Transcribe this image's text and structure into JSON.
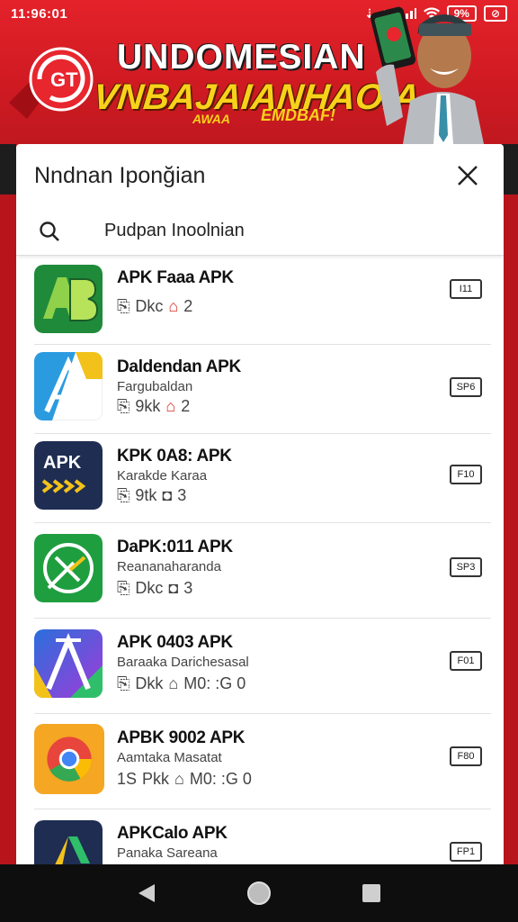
{
  "status": {
    "time": "11:96:01",
    "battery": "9%"
  },
  "banner": {
    "title_main": "UNDOMESIAN",
    "title_sub": "VNBAJAIANHAOIA",
    "title_sub2": "AWAA",
    "title_sub3": "EMDBAF!",
    "logo_text": "GT",
    "brand_color": "#d9232b",
    "accent_color": "#f7d21a"
  },
  "sheet": {
    "title": "Nndnan Iponğian",
    "search_value": "Pudpan Inoolnian"
  },
  "apps": [
    {
      "title": "APK Faaa APK",
      "subtitle": "",
      "size": "Dkc",
      "meta_icon": "gift-icon",
      "count": "2",
      "badge": "I11",
      "icon": "ab-green"
    },
    {
      "title": "Daldendan APK",
      "subtitle": "Fargubaldan",
      "size": "9kk",
      "meta_icon": "gift-icon",
      "count": "2",
      "badge": "SP6",
      "icon": "a-blue"
    },
    {
      "title": "KPK 0A8: APK",
      "subtitle": "Karakde Karaa",
      "size": "9tk",
      "meta_icon": "camera-icon",
      "count": "3",
      "badge": "F10",
      "icon": "apk-navy"
    },
    {
      "title": "DaPK:011 APK",
      "subtitle": "Reananaharanda",
      "size": "Dkc",
      "meta_icon": "camera-icon",
      "count": "3",
      "badge": "SP3",
      "icon": "check-green"
    },
    {
      "title": "APK 0403 APK",
      "subtitle": "Baraaka Darichesasal",
      "size": "Dkk",
      "meta_icon": "home-icon",
      "count": "M0: :G 0",
      "badge": "F01",
      "icon": "a-purple"
    },
    {
      "title": "APBK 9002 APK",
      "subtitle": "Aamtaka Masatat",
      "size": "Pkk",
      "size_prefix": "1S",
      "meta_icon": "home-icon",
      "count": "M0: :G 0",
      "badge": "F80",
      "icon": "chrome"
    },
    {
      "title": "APKCalo APK",
      "subtitle": "Panaka Sareana",
      "size": "",
      "meta_icon": "",
      "count": "",
      "badge": "FP1",
      "icon": "drive-navy"
    }
  ]
}
